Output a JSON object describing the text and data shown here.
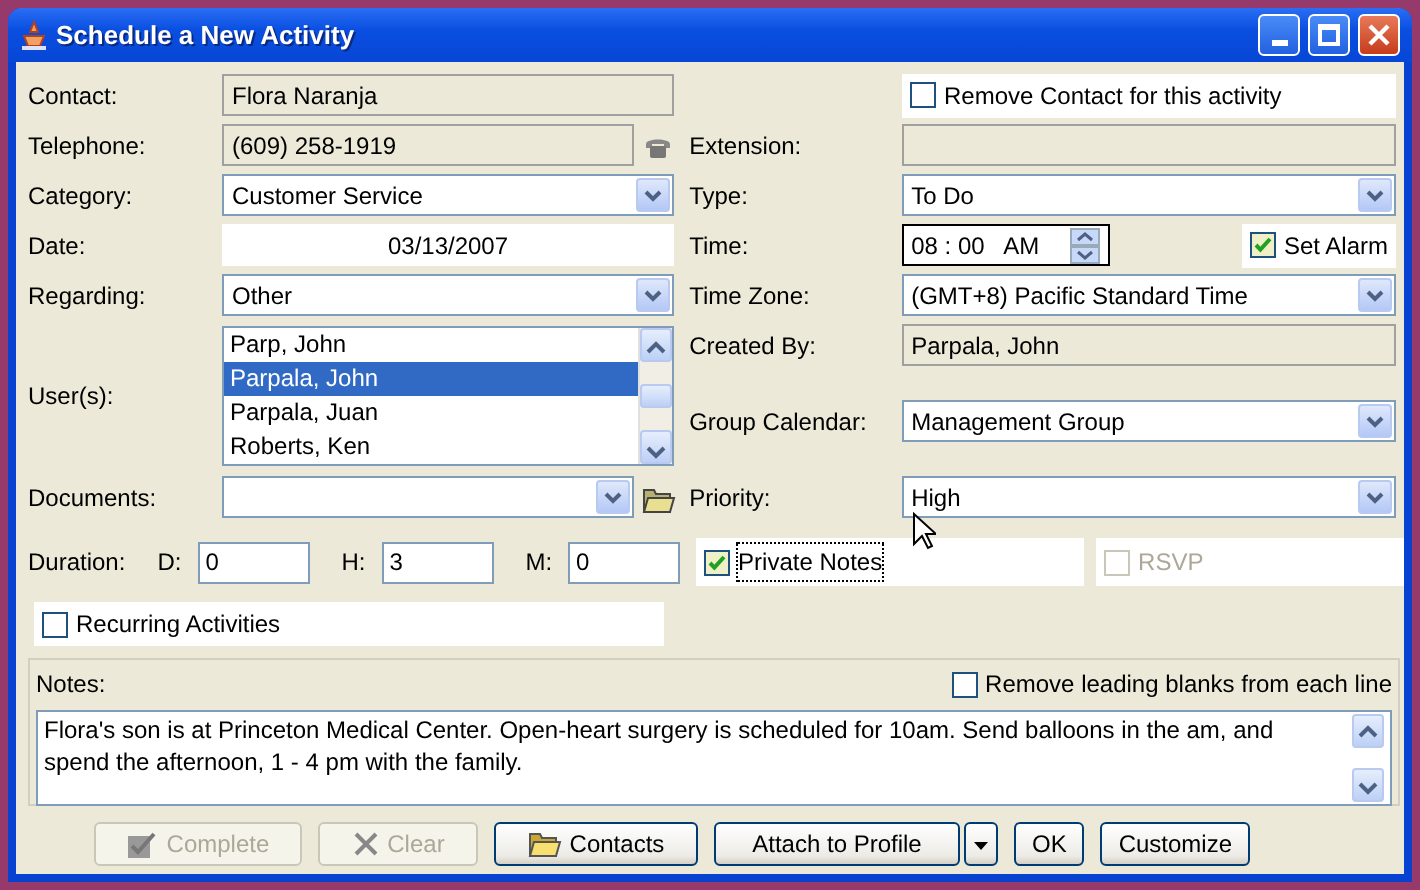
{
  "window": {
    "title": "Schedule a New Activity"
  },
  "left_fields": [
    {
      "kind": "readonly",
      "label": "Contact:",
      "value": "Flora Naranja"
    },
    {
      "kind": "phone",
      "label": "Telephone:",
      "value": "(609) 258-1919"
    },
    {
      "kind": "select",
      "label": "Category:",
      "value": "Customer Service"
    },
    {
      "kind": "date",
      "label": "Date:",
      "value": "03/13/2007"
    },
    {
      "kind": "select",
      "label": "Regarding:",
      "value": "Other"
    },
    {
      "kind": "listbox",
      "label": "User(s):",
      "items": [
        {
          "text": "Parp, John",
          "selected": false
        },
        {
          "text": "Parpala, John",
          "selected": true
        },
        {
          "text": "Parpala, Juan",
          "selected": false
        },
        {
          "text": "Roberts, Ken",
          "selected": false
        }
      ]
    },
    {
      "kind": "documents",
      "label": "Documents:"
    }
  ],
  "right_fields": [
    {
      "kind": "checkbox",
      "label": "Remove Contact for this activity",
      "checked": false
    },
    {
      "kind": "readonly",
      "label": "Extension:"
    },
    {
      "kind": "select",
      "label": "Type:",
      "value": "To Do"
    },
    {
      "kind": "time",
      "label": "Time:",
      "value": "08 : 00   AM",
      "alarm": {
        "label": "Set Alarm",
        "checked": true
      }
    },
    {
      "kind": "select",
      "label": "Time Zone:",
      "value": "(GMT+8) Pacific Standard Time"
    },
    {
      "kind": "readonly",
      "label": "Created By:",
      "value": "Parpala, John"
    },
    {
      "kind": "select",
      "label": "Group Calendar:",
      "value": "Management Group"
    },
    {
      "kind": "select",
      "label": "Priority:",
      "value": "High"
    }
  ],
  "duration": {
    "label": "Duration:",
    "parts": [
      {
        "label": "D:",
        "value": "0"
      },
      {
        "label": "H:",
        "value": "3"
      },
      {
        "label": "M:",
        "value": "0"
      }
    ]
  },
  "private_notes": {
    "label": "Private Notes",
    "checked": true,
    "focused": true
  },
  "rsvp": {
    "label": "RSVP",
    "checked": false,
    "disabled": true
  },
  "recurring": {
    "label": "Recurring Activities",
    "checked": false
  },
  "notes": {
    "label": "Notes:",
    "remove_blanks": {
      "label": "Remove leading blanks from each line",
      "checked": false
    },
    "text": "Flora's son is at Princeton Medical Center. Open-heart surgery is scheduled for 10am. Send balloons in the am, and spend the afternoon, 1 - 4 pm with the family."
  },
  "buttons": [
    {
      "kind": "complete",
      "label": "Complete",
      "disabled": true
    },
    {
      "kind": "clear",
      "label": "Clear",
      "disabled": true
    },
    {
      "kind": "contacts",
      "label": "Contacts",
      "disabled": false
    },
    {
      "kind": "split",
      "label": "Attach to Profile",
      "disabled": false
    },
    {
      "kind": "plain",
      "label": "OK",
      "disabled": false
    },
    {
      "kind": "plain",
      "label": "Customize",
      "disabled": false
    }
  ]
}
